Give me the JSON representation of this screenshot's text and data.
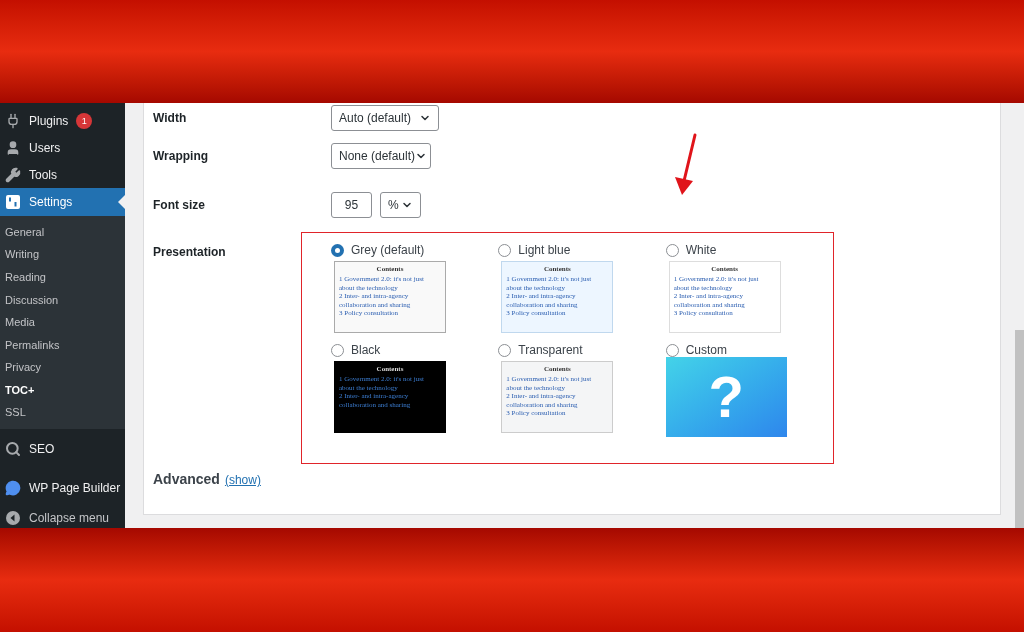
{
  "sidebar": {
    "items": [
      {
        "label": "Plugins",
        "kind": "plugin",
        "badge": "1",
        "selected": false
      },
      {
        "label": "Users",
        "kind": "user",
        "selected": false
      },
      {
        "label": "Tools",
        "kind": "wrench",
        "selected": false
      },
      {
        "label": "Settings",
        "kind": "settings",
        "selected": true
      }
    ],
    "submenu": [
      {
        "label": "General",
        "selected": false
      },
      {
        "label": "Writing",
        "selected": false
      },
      {
        "label": "Reading",
        "selected": false
      },
      {
        "label": "Discussion",
        "selected": false
      },
      {
        "label": "Media",
        "selected": false
      },
      {
        "label": "Permalinks",
        "selected": false
      },
      {
        "label": "Privacy",
        "selected": false
      },
      {
        "label": "TOC+",
        "selected": true
      },
      {
        "label": "SSL",
        "selected": false
      }
    ],
    "lower_items": [
      {
        "label": "SEO",
        "kind": "search"
      },
      {
        "label": "WP Page Builder",
        "kind": "chat"
      },
      {
        "label": "Collapse menu",
        "kind": "collapse"
      }
    ]
  },
  "settings": {
    "width": {
      "label": "Width",
      "value": "Auto (default)"
    },
    "wrapping": {
      "label": "Wrapping",
      "value": "None (default)"
    },
    "font_size": {
      "label": "Font size",
      "value": "95",
      "unit": "%"
    },
    "presentation": {
      "label": "Presentation",
      "options": [
        {
          "label": "Grey (default)",
          "kind": "grey",
          "selected": true,
          "preview": {
            "title": "Contents",
            "lines": [
              "1 Government 2.0: it's not just about the technology",
              "2 Inter- and intra-agency collaboration and sharing",
              "3 Policy consultation"
            ]
          }
        },
        {
          "label": "Light blue",
          "kind": "lightblue",
          "selected": false,
          "preview": {
            "title": "Contents",
            "lines": [
              "1 Government 2.0: it's not just about the technology",
              "2 Inter- and intra-agency collaboration and sharing",
              "3 Policy consultation"
            ]
          }
        },
        {
          "label": "White",
          "kind": "white",
          "selected": false,
          "preview": {
            "title": "Contents",
            "lines": [
              "1 Government 2.0: it's not just about the technology",
              "2 Inter- and intra-agency collaboration and sharing",
              "3 Policy consultation"
            ]
          }
        },
        {
          "label": "Black",
          "kind": "black",
          "selected": false,
          "preview": {
            "title": "Contents",
            "lines": [
              "1 Government 2.0: it's not just about the technology",
              "2 Inter- and intra-agency collaboration and sharing"
            ]
          }
        },
        {
          "label": "Transparent",
          "kind": "transparent",
          "selected": false,
          "preview": {
            "title": "Contents",
            "lines": [
              "1 Government 2.0: it's not just about the technology",
              "2 Inter- and intra-agency collaboration and sharing",
              "3 Policy consultation"
            ]
          }
        },
        {
          "label": "Custom",
          "kind": "custom",
          "selected": false,
          "mark": "?"
        }
      ]
    },
    "advanced": {
      "label": "Advanced",
      "link": "(show)"
    }
  }
}
